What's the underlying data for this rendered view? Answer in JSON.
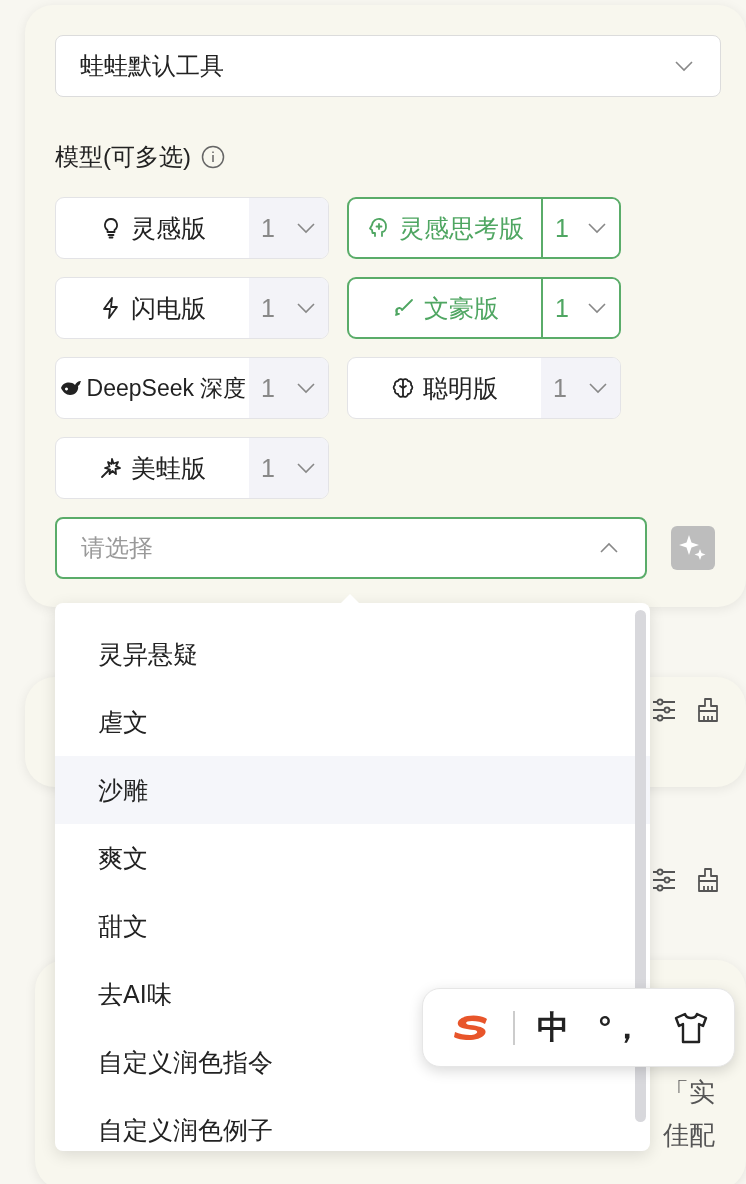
{
  "tool_select": {
    "value": "蛙蛙默认工具"
  },
  "models_label": "模型(可多选)",
  "models": [
    {
      "name": "灵感版",
      "count": "1",
      "selected": false
    },
    {
      "name": "灵感思考版",
      "count": "1",
      "selected": true
    },
    {
      "name": "闪电版",
      "count": "1",
      "selected": false
    },
    {
      "name": "文豪版",
      "count": "1",
      "selected": true
    },
    {
      "name": "DeepSeek 深度",
      "count": "1",
      "selected": false
    },
    {
      "name": "聪明版",
      "count": "1",
      "selected": false
    },
    {
      "name": "美蛙版",
      "count": "1",
      "selected": false
    }
  ],
  "genre_select": {
    "placeholder": "请选择",
    "expanded": true
  },
  "genre_options": [
    {
      "label": "灵异悬疑",
      "hovered": false
    },
    {
      "label": "虐文",
      "hovered": false
    },
    {
      "label": "沙雕",
      "hovered": true
    },
    {
      "label": "爽文",
      "hovered": false
    },
    {
      "label": "甜文",
      "hovered": false
    },
    {
      "label": "去AI味",
      "hovered": false
    },
    {
      "label": "自定义润色指令",
      "hovered": false
    },
    {
      "label": "自定义润色例子",
      "hovered": false
    }
  ],
  "background_text": [
    "「实",
    "佳配"
  ],
  "ime_toolbar": {
    "mode": "中",
    "punctuation": "°，"
  }
}
